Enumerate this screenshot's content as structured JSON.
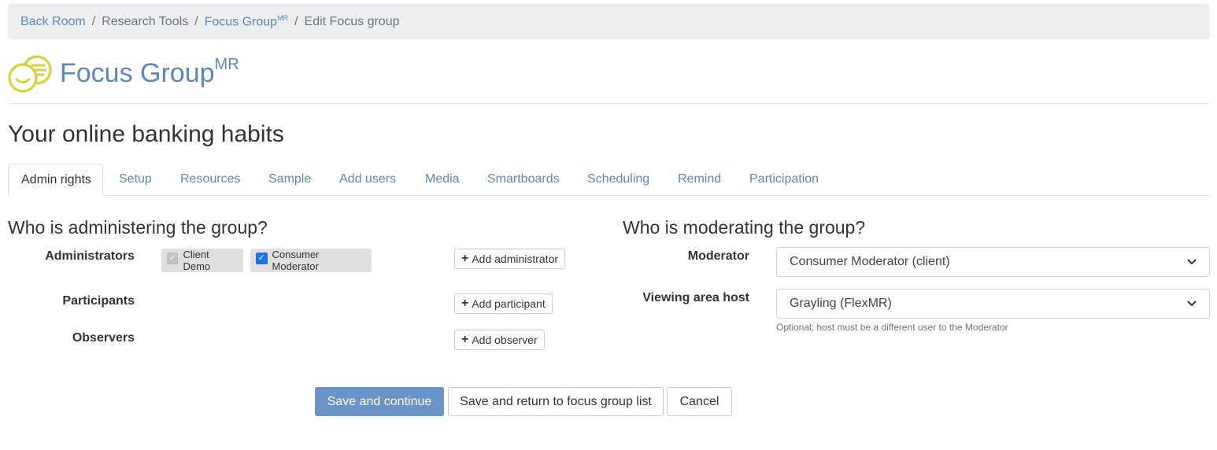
{
  "breadcrumb": {
    "item1": "Back Room",
    "item2": "Research Tools",
    "item3": "Focus Group",
    "item3_sup": "MR",
    "item4": "Edit Focus group",
    "sep": "/"
  },
  "brand": {
    "title": "Focus Group",
    "sup": "MR",
    "logo_icon": "focus-group-logo",
    "logo_color": "#d8d23a"
  },
  "page_title": "Your online banking habits",
  "tabs": [
    "Admin rights",
    "Setup",
    "Resources",
    "Sample",
    "Add users",
    "Media",
    "Smartboards",
    "Scheduling",
    "Remind",
    "Participation"
  ],
  "admin": {
    "heading": "Who is administering the group?",
    "administrators_label": "Administrators",
    "chip1": "Client Demo",
    "chip2": "Consumer Moderator",
    "add_admin": "Add administrator",
    "participants_label": "Participants",
    "add_participant": "Add participant",
    "observers_label": "Observers",
    "add_observer": "Add observer",
    "plus_icon": "+",
    "check": "✓"
  },
  "moderation": {
    "heading": "Who is moderating the group?",
    "moderator_label": "Moderator",
    "moderator_value": "Consumer Moderator (client)",
    "host_label": "Viewing area host",
    "host_value": "Grayling (FlexMR)",
    "host_help": "Optional; host must be a different user to the Moderator",
    "chevron": "⌄"
  },
  "actions": {
    "save_continue": "Save and continue",
    "save_return": "Save and return to focus group list",
    "cancel": "Cancel"
  },
  "colors": {
    "link": "#5f88b8",
    "primary": "#6a93c7"
  }
}
